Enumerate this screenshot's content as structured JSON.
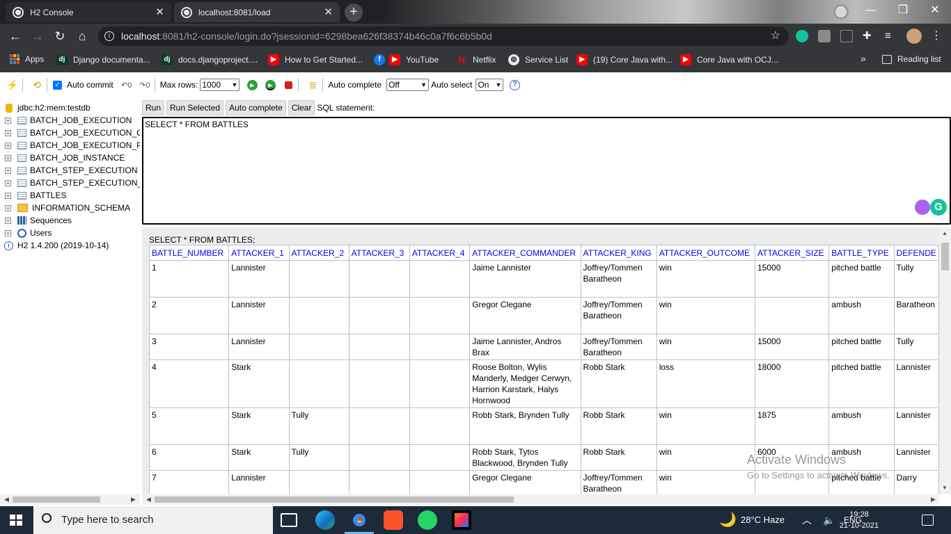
{
  "browser": {
    "tabs": [
      {
        "title": "H2 Console",
        "active": false
      },
      {
        "title": "localhost:8081/load",
        "active": true
      }
    ],
    "new_tab": "+",
    "url_host": "localhost",
    "url_rest": ":8081/h2-console/login.do?jsessionid=6298bea626f38374b46c0a7f6c6b5b0d",
    "bookmarks": [
      {
        "label": "Apps",
        "icon": "apps-grid-icon"
      },
      {
        "label": "Django documenta...",
        "icon": "django-icon"
      },
      {
        "label": "docs.djangoproject....",
        "icon": "django-icon"
      },
      {
        "label": "How to Get Started...",
        "icon": "youtube-icon"
      },
      {
        "label": "YouTube",
        "icon": "facebook-icon"
      },
      {
        "label": "Netflix",
        "icon": "netflix-icon"
      },
      {
        "label": "Service List",
        "icon": "globe-icon"
      },
      {
        "label": "(19) Core Java with...",
        "icon": "youtube-icon"
      },
      {
        "label": "Core Java with OCJ...",
        "icon": "youtube-icon"
      }
    ],
    "more_bookmarks": "»",
    "reading_list": "Reading list"
  },
  "toolbar": {
    "auto_commit": "Auto commit",
    "max_rows_label": "Max rows:",
    "max_rows_value": "1000",
    "auto_complete_label": "Auto complete",
    "auto_complete_value": "Off",
    "auto_select_label": "Auto select",
    "auto_select_value": "On",
    "help": "?"
  },
  "tree": {
    "db": "jdbc:h2:mem:testdb",
    "tables": [
      "BATCH_JOB_EXECUTION",
      "BATCH_JOB_EXECUTION_C",
      "BATCH_JOB_EXECUTION_P",
      "BATCH_JOB_INSTANCE",
      "BATCH_STEP_EXECUTION",
      "BATCH_STEP_EXECUTION_",
      "BATTLES"
    ],
    "schema": "INFORMATION_SCHEMA",
    "sequences": "Sequences",
    "users": "Users",
    "version": "H2 1.4.200 (2019-10-14)"
  },
  "commands": {
    "run": "Run",
    "run_selected": "Run Selected",
    "auto_complete": "Auto complete",
    "clear": "Clear",
    "sql_label": "SQL statement:"
  },
  "sql": "SELECT * FROM BATTLES",
  "results": {
    "statement": "SELECT * FROM BATTLES;",
    "columns": [
      "BATTLE_NUMBER",
      "ATTACKER_1",
      "ATTACKER_2",
      "ATTACKER_3",
      "ATTACKER_4",
      "ATTACKER_COMMANDER",
      "ATTACKER_KING",
      "ATTACKER_OUTCOME",
      "ATTACKER_SIZE",
      "BATTLE_TYPE",
      "DEFENDE"
    ],
    "rows": [
      [
        "1",
        "Lannister",
        "",
        "",
        "",
        "Jaime Lannister",
        "Joffrey/Tommen Baratheon",
        "win",
        "15000",
        "pitched battle",
        "Tully"
      ],
      [
        "2",
        "Lannister",
        "",
        "",
        "",
        "Gregor Clegane",
        "Joffrey/Tommen Baratheon",
        "win",
        "",
        "ambush",
        "Baratheon"
      ],
      [
        "3",
        "Lannister",
        "",
        "",
        "",
        "Jaime Lannister, Andros Brax",
        "Joffrey/Tommen Baratheon",
        "win",
        "15000",
        "pitched battle",
        "Tully"
      ],
      [
        "4",
        "Stark",
        "",
        "",
        "",
        "Roose Bolton, Wylis Manderly, Medger Cerwyn, Harrion Karstark, Halys Hornwood",
        "Robb Stark",
        "loss",
        "18000",
        "pitched battle",
        "Lannister"
      ],
      [
        "5",
        "Stark",
        "Tully",
        "",
        "",
        "Robb Stark, Brynden Tully",
        "Robb Stark",
        "win",
        "1875",
        "ambush",
        "Lannister"
      ],
      [
        "6",
        "Stark",
        "Tully",
        "",
        "",
        "Robb Stark, Tytos Blackwood, Brynden Tully",
        "Robb Stark",
        "win",
        "6000",
        "ambush",
        "Lannister"
      ],
      [
        "7",
        "Lannister",
        "",
        "",
        "",
        "Gregor Clegane",
        "Joffrey/Tommen Baratheon",
        "win",
        "",
        "pitched battle",
        "Darry"
      ]
    ]
  },
  "watermark": {
    "line1": "Activate Windows",
    "line2": "Go to Settings to activate Windows."
  },
  "taskbar": {
    "search_placeholder": "Type here to search",
    "weather": "28°C  Haze",
    "language": "ENG",
    "time": "19:28",
    "date": "21-10-2021"
  },
  "colors": {
    "link_blue": "#0000ee",
    "chrome_dark": "#35363a",
    "taskbar": "#1c2a3a"
  }
}
